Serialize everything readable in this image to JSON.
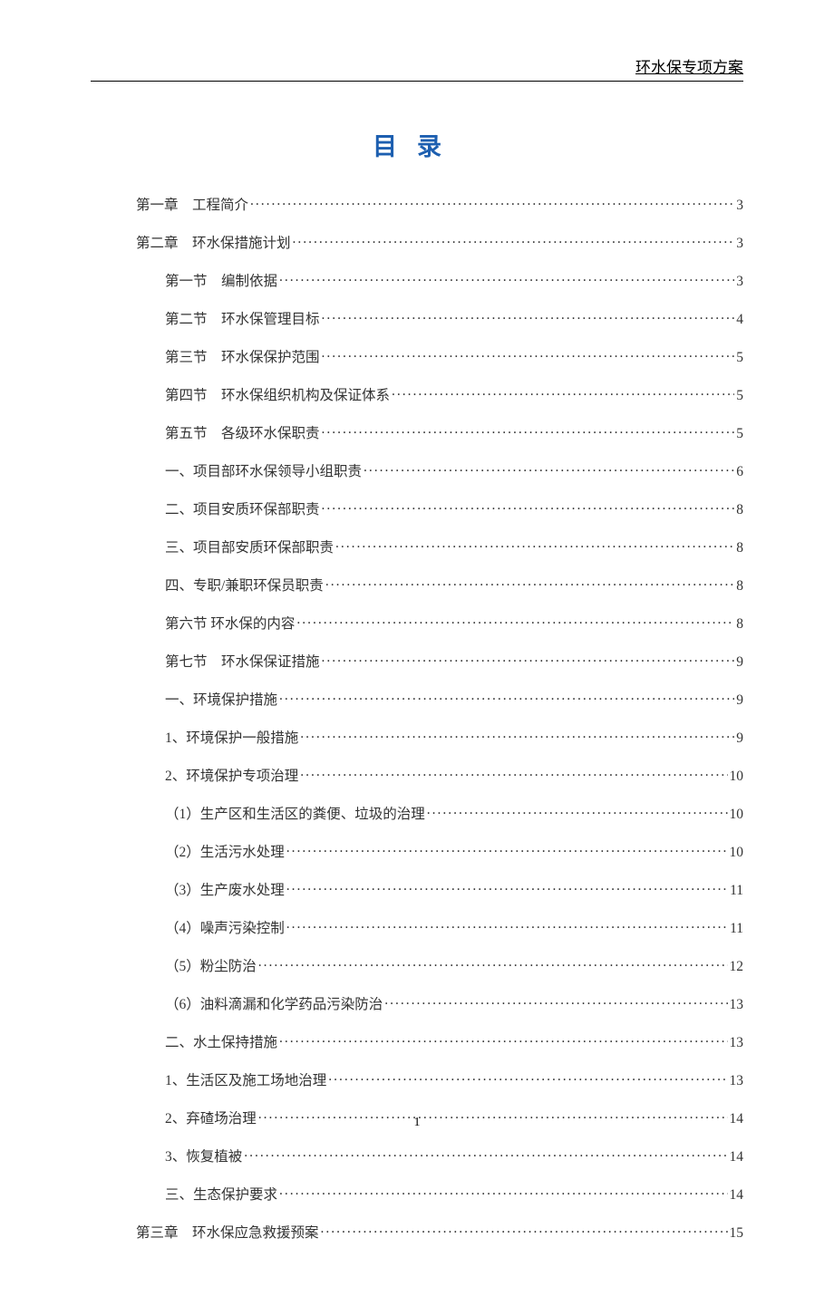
{
  "header": {
    "right_text": "环水保专项方案"
  },
  "title": "目录",
  "toc": [
    {
      "indent": 0,
      "label": "第一章　工程简介",
      "page": "3"
    },
    {
      "indent": 0,
      "label": "第二章　环水保措施计划",
      "page": "3"
    },
    {
      "indent": 1,
      "label": "第一节　编制依据",
      "page": "3"
    },
    {
      "indent": 1,
      "label": "第二节　环水保管理目标",
      "page": "4"
    },
    {
      "indent": 1,
      "label": "第三节　环水保保护范围",
      "page": "5"
    },
    {
      "indent": 1,
      "label": "第四节　环水保组织机构及保证体系",
      "page": "5"
    },
    {
      "indent": 1,
      "label": "第五节　各级环水保职责",
      "page": "5"
    },
    {
      "indent": 1,
      "label": "一、项目部环水保领导小组职责",
      "page": "6"
    },
    {
      "indent": 1,
      "label": "二、项目安质环保部职责",
      "page": "8"
    },
    {
      "indent": 1,
      "label": "三、项目部安质环保部职责",
      "page": "8"
    },
    {
      "indent": 1,
      "label": "四、专职/兼职环保员职责",
      "page": "8"
    },
    {
      "indent": 1,
      "label": "第六节 环水保的内容",
      "page": "8"
    },
    {
      "indent": 1,
      "label": "第七节　环水保保证措施",
      "page": "9"
    },
    {
      "indent": 1,
      "label": "一、环境保护措施",
      "page": "9"
    },
    {
      "indent": 1,
      "label": "1、环境保护一般措施",
      "page": "9"
    },
    {
      "indent": 1,
      "label": "2、环境保护专项治理",
      "page": "10"
    },
    {
      "indent": 1,
      "label": "（1）生产区和生活区的粪便、垃圾的治理",
      "page": "10"
    },
    {
      "indent": 1,
      "label": "（2）生活污水处理",
      "page": "10"
    },
    {
      "indent": 1,
      "label": "（3）生产废水处理",
      "page": "11"
    },
    {
      "indent": 1,
      "label": "（4）噪声污染控制",
      "page": "11"
    },
    {
      "indent": 1,
      "label": "（5）粉尘防治",
      "page": "12"
    },
    {
      "indent": 1,
      "label": "（6）油料滴漏和化学药品污染防治",
      "page": "13"
    },
    {
      "indent": 1,
      "label": "二、水土保持措施",
      "page": "13"
    },
    {
      "indent": 1,
      "label": "1、生活区及施工场地治理",
      "page": "13"
    },
    {
      "indent": 1,
      "label": "2、弃碴场治理",
      "page": "14"
    },
    {
      "indent": 1,
      "label": "3、恢复植被",
      "page": "14"
    },
    {
      "indent": 1,
      "label": "三、生态保护要求",
      "page": "14"
    },
    {
      "indent": 0,
      "label": "第三章　环水保应急救援预案",
      "page": "15"
    }
  ],
  "footer": {
    "page_number": "1"
  }
}
